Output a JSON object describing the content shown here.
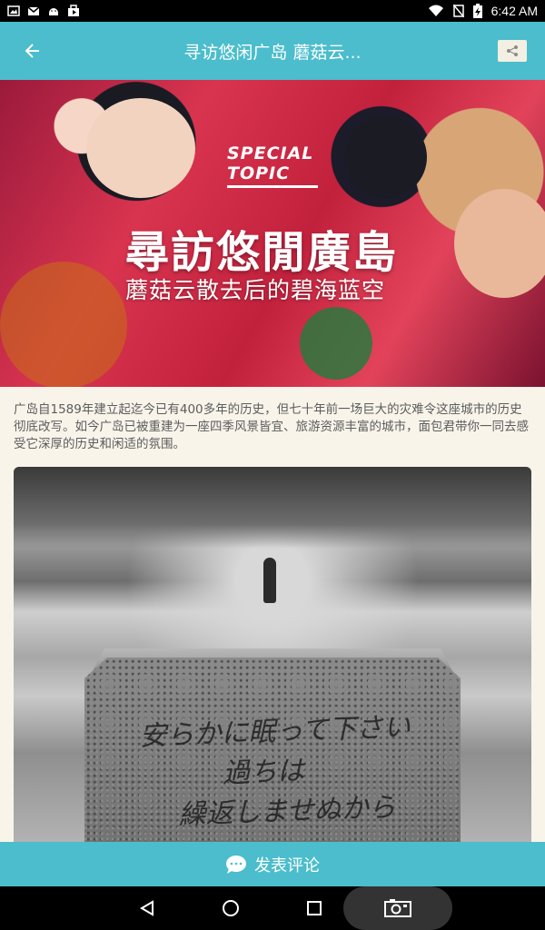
{
  "status_bar": {
    "time": "6:42 AM",
    "left_icons": [
      "image-icon",
      "gmail-icon",
      "android-icon",
      "bag-icon"
    ],
    "right_icons": [
      "wifi-icon",
      "no-sim-icon",
      "battery-charging-icon"
    ]
  },
  "app_bar": {
    "title": "寻访悠闲广岛 蘑菇云...",
    "back_icon": "arrow-left-icon",
    "share_icon": "share-icon",
    "color": "#4bbdcc"
  },
  "hero": {
    "tag_line1": "SPECIAL",
    "tag_line2": "TOPIC",
    "headline": "尋訪悠閒廣島",
    "subheadline": "蘑菇云散去后的碧海蓝空"
  },
  "intro": {
    "text": "广岛自1589年建立起迄今已有400多年的历史，但七十年前一场巨大的灾难令这座城市的历史彻底改写。如今广岛已被重建为一座四季风景皆宜、旅游资源丰富的城市，面包君带你一同去感受它深厚的历史和闲适的氛围。"
  },
  "photo": {
    "inscription_line1": "安らかに眠って下さい",
    "inscription_line2": "過ちは",
    "inscription_line3": "繰返しませぬから"
  },
  "comment_bar": {
    "label": "发表评论",
    "icon": "comment-bubble-icon"
  },
  "nav_bar": {
    "icons": [
      "back-triangle-icon",
      "home-circle-icon",
      "recents-square-icon",
      "screenshot-camera-icon"
    ]
  },
  "colors": {
    "accent": "#4bbdcc",
    "background": "#f8f4ea"
  }
}
